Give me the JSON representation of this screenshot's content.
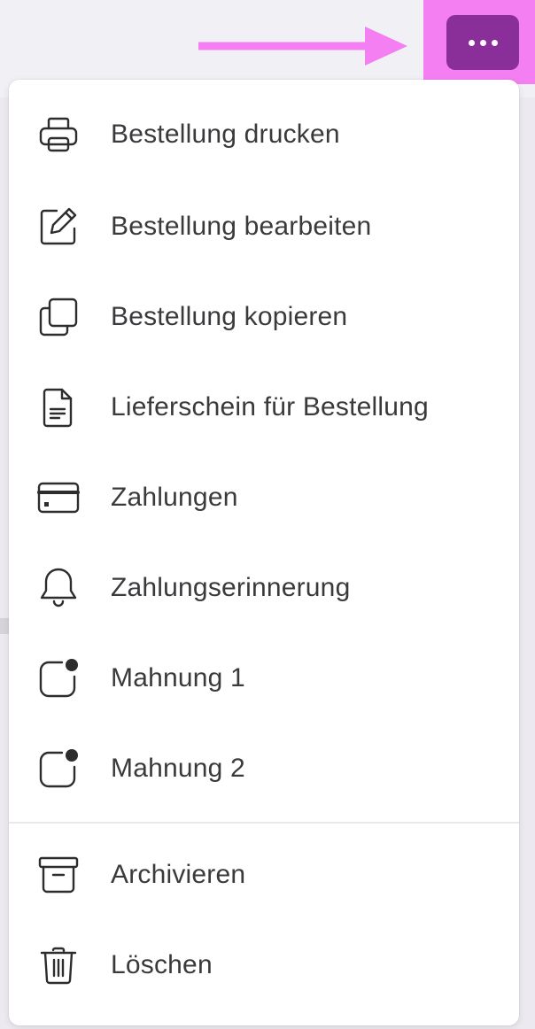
{
  "toolbar": {
    "more_button_label": "more-options",
    "accent_color": "#8a2f9a",
    "highlight_color": "#f47ff2"
  },
  "menu": {
    "items": [
      {
        "label": "Bestellung drucken",
        "icon": "printer-icon"
      },
      {
        "label": "Bestellung bearbeiten",
        "icon": "edit-icon"
      },
      {
        "label": "Bestellung kopieren",
        "icon": "copy-icon"
      },
      {
        "label": "Lieferschein für Bestellung",
        "icon": "document-icon"
      },
      {
        "label": "Zahlungen",
        "icon": "credit-card-icon"
      },
      {
        "label": "Zahlungserinnerung",
        "icon": "bell-icon"
      },
      {
        "label": "Mahnung 1",
        "icon": "notification-dot-icon"
      },
      {
        "label": "Mahnung 2",
        "icon": "notification-dot-icon"
      },
      {
        "label": "Archivieren",
        "icon": "archive-icon"
      },
      {
        "label": "Löschen",
        "icon": "trash-icon"
      }
    ]
  }
}
